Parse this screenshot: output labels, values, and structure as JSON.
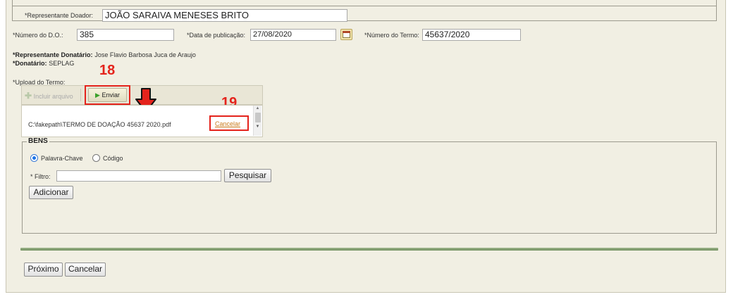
{
  "donor": {
    "representative_label": "*Representante Doador:",
    "representative_value": "JOÃO SARAIVA MENESES BRITO"
  },
  "publication": {
    "do_number_label": "*Número do D.O.:",
    "do_number_value": "385",
    "date_label": "*Data de publicação:",
    "date_value": "27/08/2020",
    "term_number_label": "*Número do Termo:",
    "term_number_value": "45637/2020"
  },
  "recipient": {
    "representative_label": "*Representante Donatário:",
    "representative_value": "Jose Flavio Barbosa Juca de Araujo",
    "recipient_label": "*Donatário:",
    "recipient_value": "SEPLAG"
  },
  "upload": {
    "label": "*Upload do Termo:",
    "add_file_label": "Incluir arquivo",
    "send_label": "Enviar",
    "file_name": "C:\\fakepath\\TERMO DE DOAÇÃO 45637 2020.pdf",
    "cancel_label": "Cancelar"
  },
  "annotations": {
    "step_18": "18",
    "step_19": "19"
  },
  "bens": {
    "legend": "BENS",
    "option_keyword": "Palavra-Chave",
    "option_code": "Código",
    "selected_option": "Palavra-Chave",
    "filter_label": "* Filtro:",
    "filter_value": "",
    "search_label": "Pesquisar",
    "add_label": "Adicionar"
  },
  "footer": {
    "next_label": "Próximo",
    "cancel_label": "Cancelar"
  },
  "colors": {
    "annotation_red": "#e4231c",
    "page_background": "#f1efe3",
    "separator_green": "#7a9a6a"
  }
}
